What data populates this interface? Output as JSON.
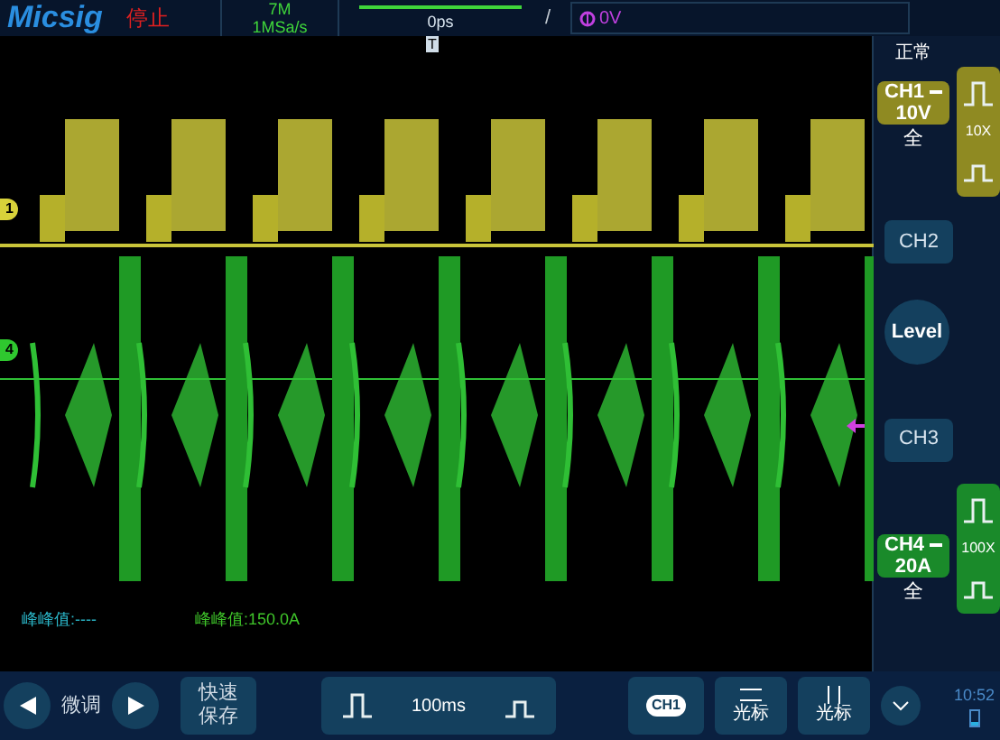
{
  "header": {
    "logo": "Micsig",
    "run_state": "停止",
    "memory_depth": "7M",
    "sample_rate": "1MSa/s",
    "trigger_position": "0ps",
    "trigger_slope": "/",
    "trigger_level": "0V",
    "trigger_marker": "T"
  },
  "measurements": [
    {
      "text": "峰峰值:----",
      "color": "#2bb7c9"
    },
    {
      "text": "峰峰值:150.0A",
      "color": "#3fc52a"
    }
  ],
  "channel_markers": [
    {
      "label": "1",
      "color": "#d8d23a"
    },
    {
      "label": "4",
      "color": "#2fc82f"
    }
  ],
  "side_panel": {
    "acquire_mode": "正常",
    "level_button": "Level",
    "channels": [
      {
        "name": "CH1",
        "scale": "10V",
        "bandwidth": "全",
        "probe": "10X",
        "color": "#8f8a22"
      },
      {
        "name": "CH2"
      },
      {
        "name": "CH3"
      },
      {
        "name": "CH4",
        "scale": "20A",
        "bandwidth": "全",
        "probe": "100X",
        "color": "#1a8a2a"
      }
    ],
    "clock": "10:52"
  },
  "bottom_bar": {
    "fine_label": "微调",
    "quick_save": "快速保存",
    "timebase": "100ms",
    "channel_badge": "CH1",
    "cursor_buttons": [
      "光标",
      "光标"
    ]
  }
}
